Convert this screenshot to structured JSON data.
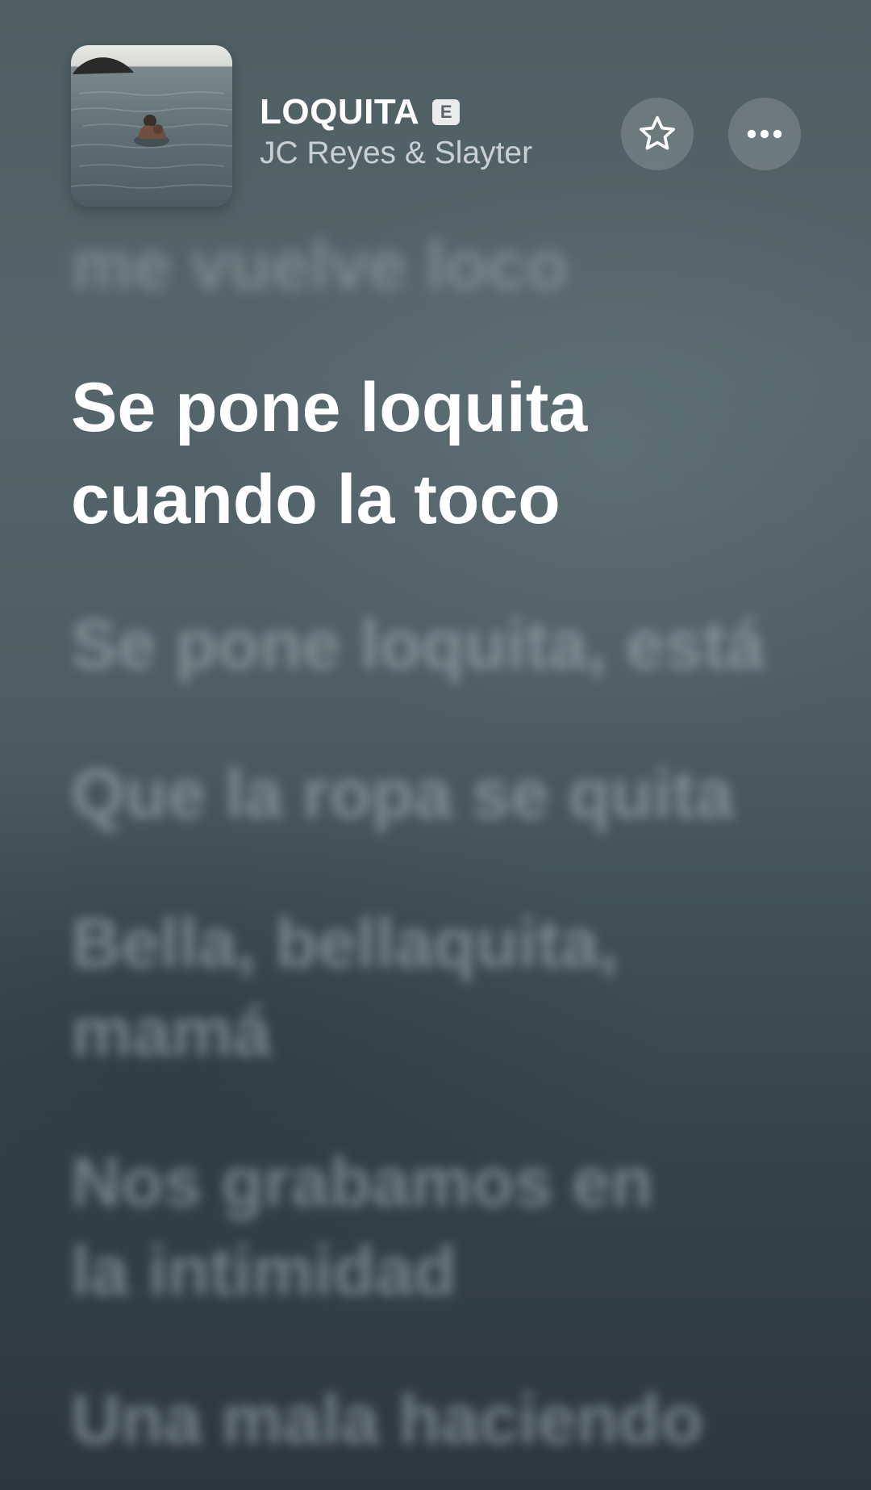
{
  "header": {
    "title": "LOQUITA",
    "explicit_badge": "E",
    "artist": "JC Reyes & Slayter",
    "artwork_icon": "album-artwork",
    "favorite_icon": "star-icon",
    "more_icon": "ellipsis-icon"
  },
  "lyrics": {
    "previous": "me vuelve loco",
    "active_line_1": "Se pone loquita",
    "active_line_2": "cuando la toco",
    "upcoming": [
      [
        "Se pone loquita, está"
      ],
      [
        "Que la ropa se quita"
      ],
      [
        "Bella, bellaquita,",
        "mamá"
      ],
      [
        "Nos grabamos en",
        "la intimidad"
      ],
      [
        "Una mala haciendo"
      ]
    ]
  },
  "colors": {
    "background_top": "#4e5f64",
    "background_bottom": "#2c3840",
    "active_text": "#ffffff"
  }
}
